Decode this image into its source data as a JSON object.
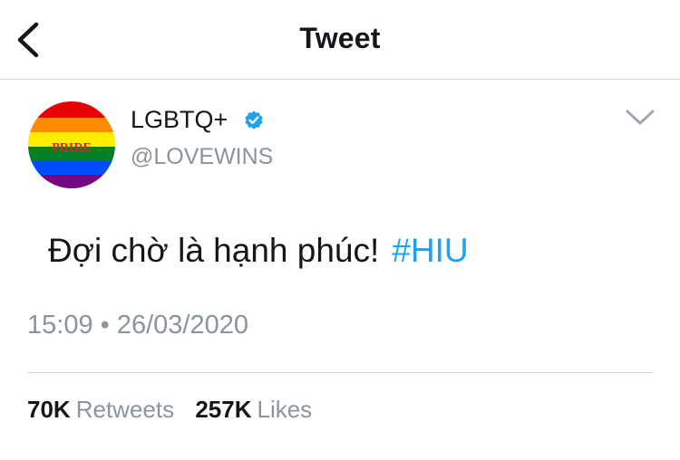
{
  "header": {
    "title": "Tweet",
    "back_icon": "chevron-left-icon"
  },
  "author": {
    "display_name": "LGBTQ+",
    "handle": "@LOVEWINS",
    "avatar_text": "PRIDE",
    "verified": true,
    "verified_color": "#1da1f2"
  },
  "tweet": {
    "text": "Đợi chờ là hạnh phúc!",
    "hashtag": "#HIU",
    "timestamp": "15:09 • 26/03/2020"
  },
  "stats": {
    "retweets_count": "70K",
    "retweets_label": "Retweets",
    "likes_count": "257K",
    "likes_label": "Likes"
  },
  "colors": {
    "accent": "#1da1f2",
    "muted": "#8a949c",
    "text": "#14171a"
  }
}
